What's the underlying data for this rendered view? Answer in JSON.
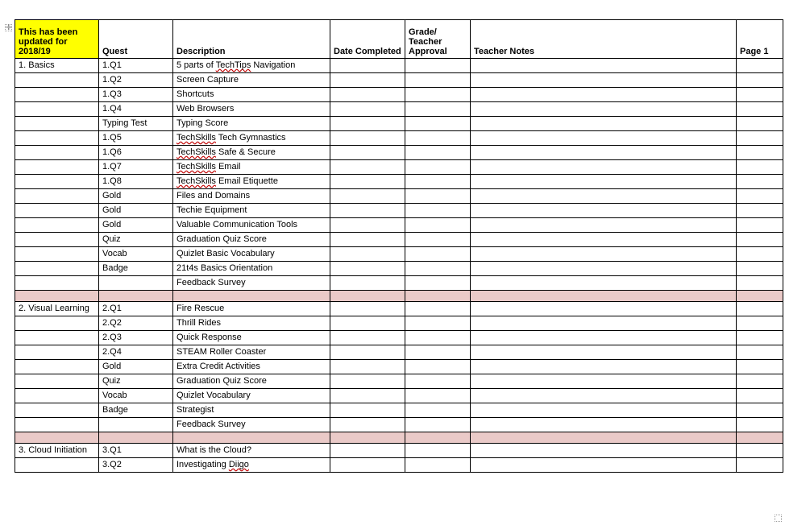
{
  "banner": "This has been updated for 2018/19",
  "handle_glyph": "✛",
  "headers": {
    "quest": "Quest",
    "description": "Description",
    "date_completed": "Date Completed",
    "grade_teacher_approval": "Grade/ Teacher Approval",
    "teacher_notes": "Teacher Notes",
    "page": "Page 1"
  },
  "sections": {
    "s1": {
      "title": "1. Basics",
      "rows": [
        {
          "quest": "1.Q1",
          "desc_pre": "5 parts of ",
          "desc_err": "TechTips",
          "desc_post": " Navigation"
        },
        {
          "quest": "1.Q2",
          "desc_pre": "Screen Capture",
          "desc_err": "",
          "desc_post": ""
        },
        {
          "quest": "1.Q3",
          "desc_pre": "Shortcuts",
          "desc_err": "",
          "desc_post": ""
        },
        {
          "quest": "1.Q4",
          "desc_pre": "Web Browsers",
          "desc_err": "",
          "desc_post": ""
        },
        {
          "quest": "Typing Test",
          "desc_pre": "Typing Score",
          "desc_err": "",
          "desc_post": ""
        },
        {
          "quest": "1.Q5",
          "desc_pre": "",
          "desc_err": "TechSkills",
          "desc_post": " Tech Gymnastics"
        },
        {
          "quest": "1.Q6",
          "desc_pre": "",
          "desc_err": "TechSkills",
          "desc_post": " Safe & Secure"
        },
        {
          "quest": "1.Q7",
          "desc_pre": "",
          "desc_err": "TechSkills",
          "desc_post": " Email"
        },
        {
          "quest": "1.Q8",
          "desc_pre": "",
          "desc_err": "TechSkills",
          "desc_post": " Email Etiquette"
        },
        {
          "quest": "Gold",
          "desc_pre": "Files and Domains",
          "desc_err": "",
          "desc_post": ""
        },
        {
          "quest": "Gold",
          "desc_pre": "Techie Equipment",
          "desc_err": "",
          "desc_post": ""
        },
        {
          "quest": "Gold",
          "desc_pre": "Valuable Communication Tools",
          "desc_err": "",
          "desc_post": ""
        },
        {
          "quest": "Quiz",
          "desc_pre": "Graduation Quiz Score",
          "desc_err": "",
          "desc_post": ""
        },
        {
          "quest": "Vocab",
          "desc_pre": "Quizlet Basic Vocabulary",
          "desc_err": "",
          "desc_post": ""
        },
        {
          "quest": "Badge",
          "desc_pre": "21t4s Basics Orientation",
          "desc_err": "",
          "desc_post": ""
        },
        {
          "quest": "",
          "desc_pre": "Feedback Survey",
          "desc_err": "",
          "desc_post": ""
        }
      ]
    },
    "s2": {
      "title": "2. Visual Learning",
      "rows": [
        {
          "quest": "2.Q1",
          "desc_pre": "Fire Rescue",
          "desc_err": "",
          "desc_post": ""
        },
        {
          "quest": "2.Q2",
          "desc_pre": "Thrill Rides",
          "desc_err": "",
          "desc_post": ""
        },
        {
          "quest": "2.Q3",
          "desc_pre": "Quick Response",
          "desc_err": "",
          "desc_post": ""
        },
        {
          "quest": "2.Q4",
          "desc_pre": "STEAM Roller Coaster",
          "desc_err": "",
          "desc_post": ""
        },
        {
          "quest": "Gold",
          "desc_pre": "Extra Credit Activities",
          "desc_err": "",
          "desc_post": ""
        },
        {
          "quest": "Quiz",
          "desc_pre": "Graduation Quiz Score",
          "desc_err": "",
          "desc_post": ""
        },
        {
          "quest": "Vocab",
          "desc_pre": "Quizlet Vocabulary",
          "desc_err": "",
          "desc_post": ""
        },
        {
          "quest": "Badge",
          "desc_pre": "Strategist",
          "desc_err": "",
          "desc_post": ""
        },
        {
          "quest": "",
          "desc_pre": "Feedback Survey",
          "desc_err": "",
          "desc_post": ""
        }
      ]
    },
    "s3": {
      "title": "3. Cloud Initiation",
      "rows": [
        {
          "quest": "3.Q1",
          "desc_pre": "What is the Cloud?",
          "desc_err": "",
          "desc_post": ""
        },
        {
          "quest": "3.Q2",
          "desc_pre": "Investigating ",
          "desc_err": "Diigo",
          "desc_post": ""
        }
      ]
    }
  }
}
